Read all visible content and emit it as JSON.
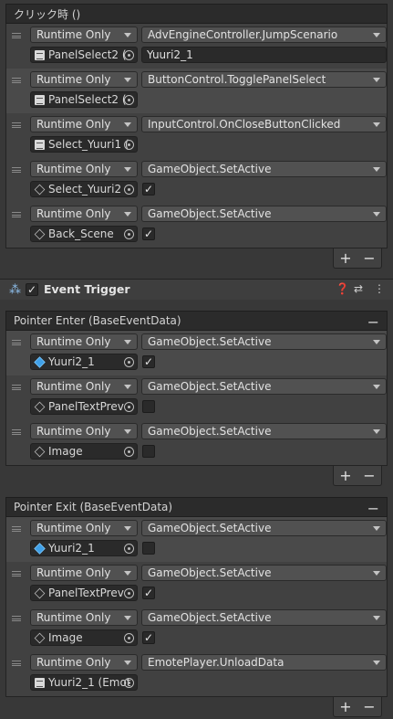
{
  "component": {
    "title": "Event Trigger",
    "icons": [
      "event-trigger-icon",
      "help-icon",
      "preset-icon",
      "more-icon"
    ],
    "enabled": true
  },
  "footer": {
    "plus": "+",
    "minus": "−"
  },
  "header_minus": "−",
  "groups": [
    {
      "title": "クリック時 ()",
      "entries": [
        {
          "runtime": "Runtime Only",
          "function": "AdvEngineController.JumpScenario",
          "object": "PanelSelect2 (",
          "object_icon": "script",
          "argument_type": "text",
          "argument": "Yuuri2_1",
          "active": false
        },
        {
          "runtime": "Runtime Only",
          "function": "ButtonControl.TogglePanelSelect",
          "object": "PanelSelect2 (",
          "object_icon": "script",
          "argument_type": "none",
          "active": true
        },
        {
          "runtime": "Runtime Only",
          "function": "InputControl.OnCloseButtonClicked",
          "object": "Select_Yuuri1 (",
          "object_icon": "script",
          "argument_type": "none",
          "active": false
        },
        {
          "runtime": "Runtime Only",
          "function": "GameObject.SetActive",
          "object": "Select_Yuuri2",
          "object_icon": "cube",
          "argument_type": "bool",
          "argument": true,
          "active": false
        },
        {
          "runtime": "Runtime Only",
          "function": "GameObject.SetActive",
          "object": "Back_Scene",
          "object_icon": "cube",
          "argument_type": "bool",
          "argument": true,
          "active": false
        }
      ]
    },
    {
      "title": "Pointer Enter (BaseEventData)",
      "entries": [
        {
          "runtime": "Runtime Only",
          "function": "GameObject.SetActive",
          "object": "Yuuri2_1",
          "object_icon": "bluecube",
          "argument_type": "bool",
          "argument": true,
          "active": true
        },
        {
          "runtime": "Runtime Only",
          "function": "GameObject.SetActive",
          "object": "PanelTextPrev",
          "object_icon": "cube",
          "argument_type": "bool",
          "argument": false,
          "active": false
        },
        {
          "runtime": "Runtime Only",
          "function": "GameObject.SetActive",
          "object": "Image",
          "object_icon": "cube",
          "argument_type": "bool",
          "argument": false,
          "active": false
        }
      ]
    },
    {
      "title": "Pointer Exit (BaseEventData)",
      "entries": [
        {
          "runtime": "Runtime Only",
          "function": "GameObject.SetActive",
          "object": "Yuuri2_1",
          "object_icon": "bluecube",
          "argument_type": "bool",
          "argument": false,
          "active": true
        },
        {
          "runtime": "Runtime Only",
          "function": "GameObject.SetActive",
          "object": "PanelTextPrev",
          "object_icon": "cube",
          "argument_type": "bool",
          "argument": true,
          "active": false
        },
        {
          "runtime": "Runtime Only",
          "function": "GameObject.SetActive",
          "object": "Image",
          "object_icon": "cube",
          "argument_type": "bool",
          "argument": true,
          "active": false
        },
        {
          "runtime": "Runtime Only",
          "function": "EmotePlayer.UnloadData",
          "object": "Yuuri2_1 (Emot",
          "object_icon": "script",
          "argument_type": "none",
          "active": false
        }
      ]
    }
  ]
}
